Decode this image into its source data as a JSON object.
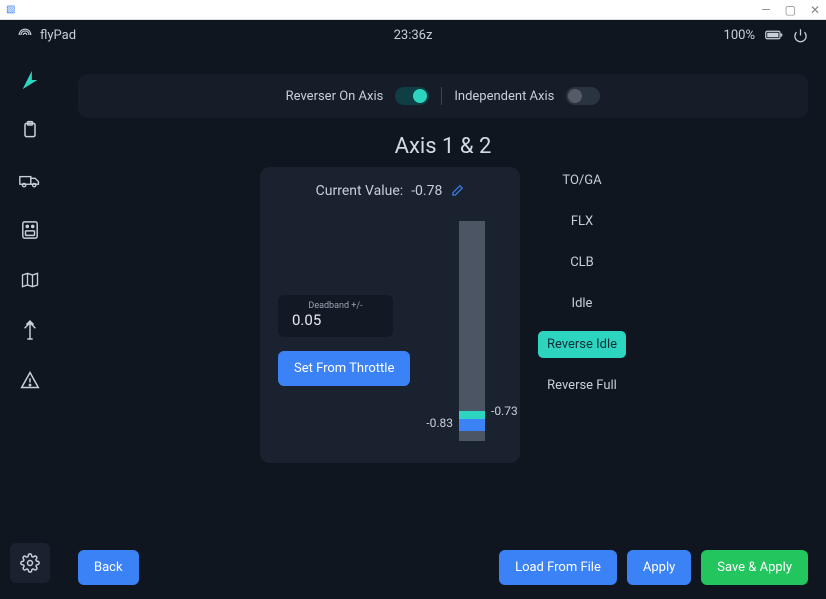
{
  "window": {
    "app_icon_title": ""
  },
  "header": {
    "app_name": "flyPad",
    "time": "23:36z",
    "battery": "100%"
  },
  "toggles": {
    "reverser_label": "Reverser On Axis",
    "reverser_on": true,
    "independent_label": "Independent Axis",
    "independent_on": false
  },
  "axis": {
    "title": "Axis 1 & 2",
    "current_label": "Current Value:",
    "current_value": "-0.78",
    "deadband_label": "Deadband +/-",
    "deadband_value": "0.05",
    "set_from_throttle": "Set From Throttle",
    "range_upper": "-0.73",
    "range_lower": "-0.83"
  },
  "detents": {
    "items": [
      "TO/GA",
      "FLX",
      "CLB",
      "Idle",
      "Reverse Idle",
      "Reverse Full"
    ],
    "active_index": 4
  },
  "footer": {
    "back": "Back",
    "load": "Load From File",
    "apply": "Apply",
    "save": "Save & Apply"
  },
  "colors": {
    "teal": "#2dd4bf",
    "blue": "#3b82f6",
    "green": "#22c55e"
  }
}
